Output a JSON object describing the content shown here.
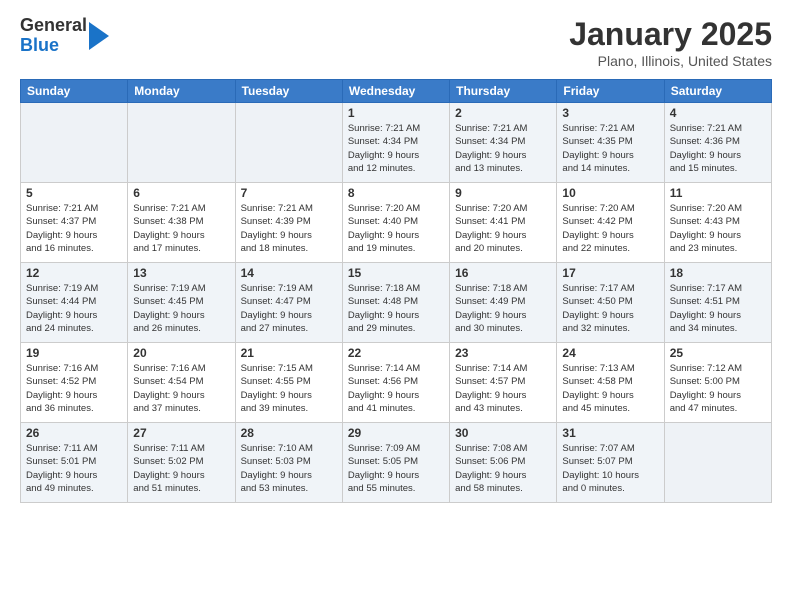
{
  "header": {
    "logo_general": "General",
    "logo_blue": "Blue",
    "month_title": "January 2025",
    "location": "Plano, Illinois, United States"
  },
  "weekdays": [
    "Sunday",
    "Monday",
    "Tuesday",
    "Wednesday",
    "Thursday",
    "Friday",
    "Saturday"
  ],
  "weeks": [
    [
      {
        "day": "",
        "info": ""
      },
      {
        "day": "",
        "info": ""
      },
      {
        "day": "",
        "info": ""
      },
      {
        "day": "1",
        "info": "Sunrise: 7:21 AM\nSunset: 4:34 PM\nDaylight: 9 hours\nand 12 minutes."
      },
      {
        "day": "2",
        "info": "Sunrise: 7:21 AM\nSunset: 4:34 PM\nDaylight: 9 hours\nand 13 minutes."
      },
      {
        "day": "3",
        "info": "Sunrise: 7:21 AM\nSunset: 4:35 PM\nDaylight: 9 hours\nand 14 minutes."
      },
      {
        "day": "4",
        "info": "Sunrise: 7:21 AM\nSunset: 4:36 PM\nDaylight: 9 hours\nand 15 minutes."
      }
    ],
    [
      {
        "day": "5",
        "info": "Sunrise: 7:21 AM\nSunset: 4:37 PM\nDaylight: 9 hours\nand 16 minutes."
      },
      {
        "day": "6",
        "info": "Sunrise: 7:21 AM\nSunset: 4:38 PM\nDaylight: 9 hours\nand 17 minutes."
      },
      {
        "day": "7",
        "info": "Sunrise: 7:21 AM\nSunset: 4:39 PM\nDaylight: 9 hours\nand 18 minutes."
      },
      {
        "day": "8",
        "info": "Sunrise: 7:20 AM\nSunset: 4:40 PM\nDaylight: 9 hours\nand 19 minutes."
      },
      {
        "day": "9",
        "info": "Sunrise: 7:20 AM\nSunset: 4:41 PM\nDaylight: 9 hours\nand 20 minutes."
      },
      {
        "day": "10",
        "info": "Sunrise: 7:20 AM\nSunset: 4:42 PM\nDaylight: 9 hours\nand 22 minutes."
      },
      {
        "day": "11",
        "info": "Sunrise: 7:20 AM\nSunset: 4:43 PM\nDaylight: 9 hours\nand 23 minutes."
      }
    ],
    [
      {
        "day": "12",
        "info": "Sunrise: 7:19 AM\nSunset: 4:44 PM\nDaylight: 9 hours\nand 24 minutes."
      },
      {
        "day": "13",
        "info": "Sunrise: 7:19 AM\nSunset: 4:45 PM\nDaylight: 9 hours\nand 26 minutes."
      },
      {
        "day": "14",
        "info": "Sunrise: 7:19 AM\nSunset: 4:47 PM\nDaylight: 9 hours\nand 27 minutes."
      },
      {
        "day": "15",
        "info": "Sunrise: 7:18 AM\nSunset: 4:48 PM\nDaylight: 9 hours\nand 29 minutes."
      },
      {
        "day": "16",
        "info": "Sunrise: 7:18 AM\nSunset: 4:49 PM\nDaylight: 9 hours\nand 30 minutes."
      },
      {
        "day": "17",
        "info": "Sunrise: 7:17 AM\nSunset: 4:50 PM\nDaylight: 9 hours\nand 32 minutes."
      },
      {
        "day": "18",
        "info": "Sunrise: 7:17 AM\nSunset: 4:51 PM\nDaylight: 9 hours\nand 34 minutes."
      }
    ],
    [
      {
        "day": "19",
        "info": "Sunrise: 7:16 AM\nSunset: 4:52 PM\nDaylight: 9 hours\nand 36 minutes."
      },
      {
        "day": "20",
        "info": "Sunrise: 7:16 AM\nSunset: 4:54 PM\nDaylight: 9 hours\nand 37 minutes."
      },
      {
        "day": "21",
        "info": "Sunrise: 7:15 AM\nSunset: 4:55 PM\nDaylight: 9 hours\nand 39 minutes."
      },
      {
        "day": "22",
        "info": "Sunrise: 7:14 AM\nSunset: 4:56 PM\nDaylight: 9 hours\nand 41 minutes."
      },
      {
        "day": "23",
        "info": "Sunrise: 7:14 AM\nSunset: 4:57 PM\nDaylight: 9 hours\nand 43 minutes."
      },
      {
        "day": "24",
        "info": "Sunrise: 7:13 AM\nSunset: 4:58 PM\nDaylight: 9 hours\nand 45 minutes."
      },
      {
        "day": "25",
        "info": "Sunrise: 7:12 AM\nSunset: 5:00 PM\nDaylight: 9 hours\nand 47 minutes."
      }
    ],
    [
      {
        "day": "26",
        "info": "Sunrise: 7:11 AM\nSunset: 5:01 PM\nDaylight: 9 hours\nand 49 minutes."
      },
      {
        "day": "27",
        "info": "Sunrise: 7:11 AM\nSunset: 5:02 PM\nDaylight: 9 hours\nand 51 minutes."
      },
      {
        "day": "28",
        "info": "Sunrise: 7:10 AM\nSunset: 5:03 PM\nDaylight: 9 hours\nand 53 minutes."
      },
      {
        "day": "29",
        "info": "Sunrise: 7:09 AM\nSunset: 5:05 PM\nDaylight: 9 hours\nand 55 minutes."
      },
      {
        "day": "30",
        "info": "Sunrise: 7:08 AM\nSunset: 5:06 PM\nDaylight: 9 hours\nand 58 minutes."
      },
      {
        "day": "31",
        "info": "Sunrise: 7:07 AM\nSunset: 5:07 PM\nDaylight: 10 hours\nand 0 minutes."
      },
      {
        "day": "",
        "info": ""
      }
    ]
  ]
}
